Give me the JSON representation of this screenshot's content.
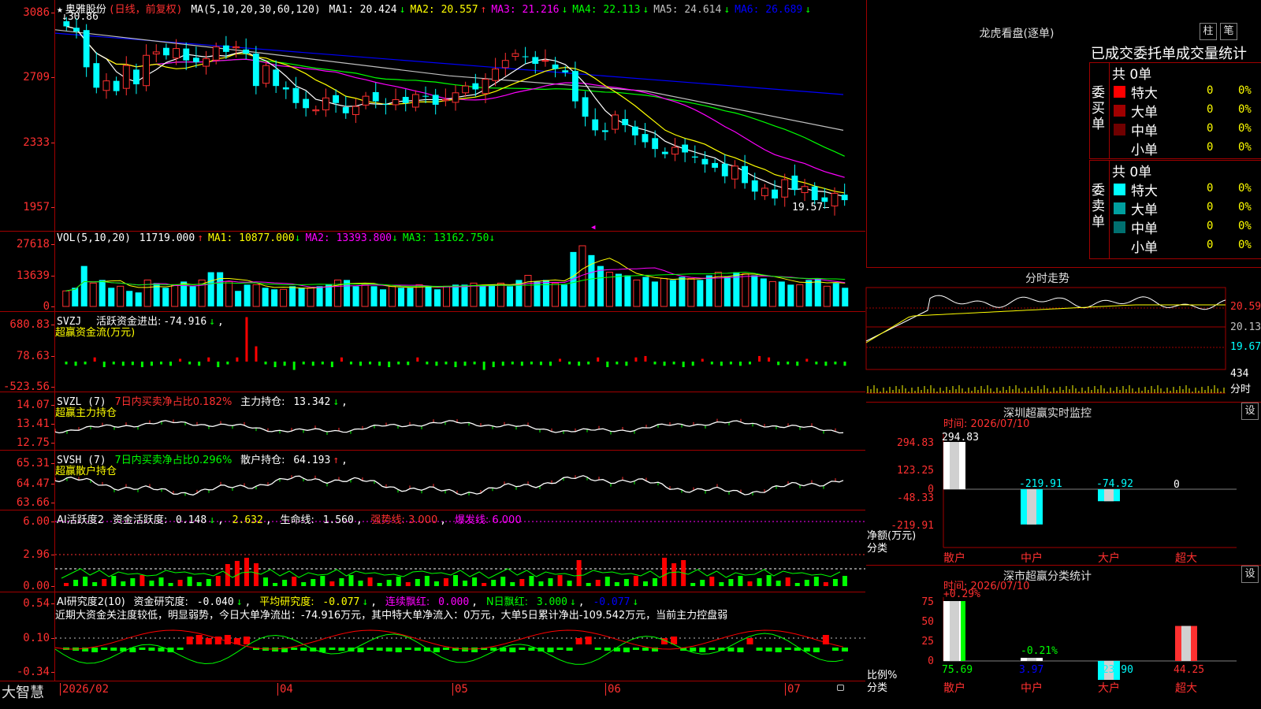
{
  "colors": {
    "up": "#ff3030",
    "down": "#00ffff",
    "bg": "#000000",
    "grid": "#a00000",
    "ma1": "#ffffff",
    "ma2": "#ffff00",
    "ma3": "#ff00ff",
    "ma4": "#00ff00",
    "ma5": "#c0c0c0",
    "ma6": "#0000ff",
    "green": "#00ff00"
  },
  "stock": {
    "name": "奥雅股份",
    "mode": "(日线，前复权)",
    "high_label": "30.86",
    "low_label": "19.57"
  },
  "kline": {
    "ma_legend": "MA(5,10,20,30,60,120)",
    "ma": [
      {
        "name": "MA1:",
        "value": "20.424",
        "arrow": "↓",
        "color": "#ffffff"
      },
      {
        "name": "MA2:",
        "value": "20.557",
        "arrow": "↑",
        "color": "#ffff00"
      },
      {
        "name": "MA3:",
        "value": "21.216",
        "arrow": "↓",
        "color": "#ff00ff"
      },
      {
        "name": "MA4:",
        "value": "22.113",
        "arrow": "↓",
        "color": "#00ff00"
      },
      {
        "name": "MA5:",
        "value": "24.614",
        "arrow": "↓",
        "color": "#c0c0c0"
      },
      {
        "name": "MA6:",
        "value": "26.689",
        "arrow": "↓",
        "color": "#0000ff"
      }
    ],
    "yticks": [
      "3086",
      "2709",
      "2333",
      "1957"
    ],
    "ylim": [
      19.2,
      31.5
    ],
    "closes": [
      30.6,
      30.3,
      28.2,
      27.0,
      27.4,
      26.8,
      28.3,
      27.2,
      28.9,
      29.1,
      28.9,
      29.3,
      28.6,
      28.5,
      28.7,
      29.4,
      29.1,
      29.4,
      29.0,
      27.1,
      28.3,
      27.1,
      26.9,
      26.1,
      25.8,
      25.7,
      26.4,
      26.1,
      25.5,
      25.9,
      26.5,
      26.2,
      26.0,
      26.3,
      26.1,
      26.6,
      26.5,
      26.0,
      26.3,
      26.7,
      27.1,
      26.9,
      27.5,
      28.1,
      28.6,
      29.0,
      28.8,
      28.4,
      28.6,
      28.1,
      27.9,
      26.2,
      25.3,
      24.5,
      24.4,
      25.4,
      24.8,
      24.2,
      23.8,
      23.4,
      23.1,
      23.5,
      23.2,
      22.9,
      22.5,
      22.3,
      21.8,
      22.4,
      21.4,
      20.9,
      21.1,
      20.5,
      21.6,
      21.0,
      21.2,
      20.4,
      20.3,
      20.8,
      20.4
    ]
  },
  "vol": {
    "legend_name": "VOL(5,10,20)",
    "value": "11719.000",
    "arrow": "↑",
    "ma": [
      {
        "name": "MA1:",
        "value": "10877.000",
        "arrow": "↓",
        "color": "#ffff00"
      },
      {
        "name": "MA2:",
        "value": "13393.800",
        "arrow": "↓",
        "color": "#ff00ff"
      },
      {
        "name": "MA3:",
        "value": "13162.750",
        "arrow": "↓",
        "color": "#00ff00"
      }
    ],
    "yticks": [
      "27618",
      "13639",
      "0"
    ],
    "values": [
      10,
      12,
      26,
      15,
      17,
      12,
      13,
      10,
      9,
      17,
      15,
      12,
      14,
      16,
      13,
      17,
      22,
      22,
      16,
      10,
      14,
      14,
      12,
      11,
      11,
      13,
      12,
      12,
      13,
      14,
      17,
      17,
      13,
      14,
      13,
      11,
      13,
      12,
      12,
      14,
      13,
      11,
      13,
      14,
      14,
      15,
      13,
      14,
      15,
      13,
      17,
      20,
      16,
      17,
      15,
      14,
      35,
      39,
      33,
      26,
      22,
      21,
      20,
      17,
      19,
      16,
      18,
      17,
      19,
      18,
      17,
      20,
      22,
      19,
      22,
      21,
      20,
      18,
      16,
      16,
      14,
      14,
      17,
      18,
      13,
      15,
      12
    ]
  },
  "svzj": {
    "title": "SVZJ",
    "label": "活跃资金进出:",
    "value": "-74.916",
    "arrow": "↓",
    "sub": "超赢资金流(万元)",
    "yticks": [
      "680.83",
      "78.63",
      "-523.56"
    ],
    "values": [
      -40,
      -60,
      -40,
      60,
      -80,
      -40,
      -60,
      -50,
      -80,
      -60,
      -40,
      -60,
      40,
      -40,
      -60,
      60,
      -80,
      -40,
      60,
      640,
      220,
      -40,
      -80,
      -60,
      -120,
      -40,
      -60,
      -40,
      -80,
      60,
      -40,
      -60,
      -40,
      -60,
      -80,
      -40,
      -50,
      60,
      -40,
      -60,
      -40,
      -80,
      -60,
      -40,
      -120,
      -80,
      -60,
      -40,
      -60,
      -40,
      -50,
      -60,
      40,
      -40,
      -60,
      -40,
      60,
      -80,
      -40,
      -60,
      60,
      80,
      -40,
      -60,
      -40,
      -80,
      -60,
      40,
      -40,
      -60,
      -40,
      -60,
      -40,
      80,
      60,
      -50,
      -40,
      -60,
      40,
      -40,
      -60,
      -40,
      -60
    ]
  },
  "svzl": {
    "title": "SVZL (7)",
    "label_ratio": "7日内买卖净占比0.182%",
    "label_main": "主力持仓:",
    "value": "13.342",
    "arrow": "↓",
    "sub": "超赢主力持仓",
    "yticks": [
      "14.07",
      "13.41",
      "12.75"
    ]
  },
  "svsh": {
    "title": "SVSH (7)",
    "label_ratio": "7日内买卖净占比0.296%",
    "label_main": "散户持仓:",
    "value": "64.193",
    "arrow": "↑",
    "sub": "超赢散户持仓",
    "yticks": [
      "65.31",
      "64.47",
      "63.66"
    ]
  },
  "ai1": {
    "title": "AI活跃度2",
    "label": "资金活跃度:",
    "value": "0.148",
    "arrow": "↓",
    "v2": "2.632",
    "life_label": "生命线:",
    "life": "1.560",
    "strong": "强势线: 3.000",
    "burst": "爆发线: 6.000",
    "yticks": [
      "6.00",
      "2.96",
      "0.00"
    ]
  },
  "ai2": {
    "title": "AI研究度2(10)",
    "label1": "资金研究度:",
    "v1": "-0.040",
    "label2": "平均研究度:",
    "v2": "-0.077",
    "label3": "连续飘红:",
    "v3": "0.000",
    "label4": "N日飘红:",
    "v4": "3.000",
    "v5": "-0.077",
    "commentary": "近期大资金关注度较低，明显弱势，今日大单净流出：-74.916万元，其中特大单净流入：0万元，大单5日累计净出-109.542万元，当前主力控盘弱",
    "yticks": [
      "0.54",
      "0.10",
      "-0.34"
    ]
  },
  "xaxis": {
    "labels": [
      "2026/02",
      "04",
      "05",
      "06",
      "07"
    ],
    "brand": "大智慧"
  },
  "longhu": {
    "title": "龙虎看盘(逐单)",
    "btn1": "柱",
    "btn2": "笔",
    "header": "已成交委托单成交量统计",
    "buy": {
      "title": "委买单",
      "total": "共 0单",
      "rows": [
        {
          "label": "特大",
          "vol": "0",
          "pct": "0%",
          "color": "#ff0000"
        },
        {
          "label": "大单",
          "vol": "0",
          "pct": "0%",
          "color": "#a00000"
        },
        {
          "label": "中单",
          "vol": "0",
          "pct": "0%",
          "color": "#700000"
        },
        {
          "label": "小单",
          "vol": "0",
          "pct": "0%",
          "color": ""
        }
      ]
    },
    "sell": {
      "title": "委卖单",
      "total": "共 0单",
      "rows": [
        {
          "label": "特大",
          "vol": "0",
          "pct": "0%",
          "color": "#00ffff"
        },
        {
          "label": "大单",
          "vol": "0",
          "pct": "0%",
          "color": "#00a0a0"
        },
        {
          "label": "中单",
          "vol": "0",
          "pct": "0%",
          "color": "#007070"
        },
        {
          "label": "小单",
          "vol": "0",
          "pct": "0%",
          "color": ""
        }
      ]
    }
  },
  "intraday": {
    "title": "分时走势",
    "p1": "20.59",
    "p2": "20.13",
    "p3": "19.67",
    "vol": "434",
    "vol_label": "分时"
  },
  "sz_monitor": {
    "title": "深圳超赢实时监控",
    "btn": "设",
    "time": "时间: 2026/07/10",
    "yticks": [
      "294.83",
      "123.25",
      "0",
      "-48.33",
      "-219.91"
    ],
    "ylabel": "净额(万元)",
    "xlabel": "分类",
    "bars": [
      {
        "cat": "散户",
        "value": 294.83,
        "label": "294.83"
      },
      {
        "cat": "中户",
        "value": -219.91,
        "label": "-219.91"
      },
      {
        "cat": "大户",
        "value": -74.92,
        "label": "-74.92"
      },
      {
        "cat": "超大",
        "value": 0,
        "label": "0"
      }
    ]
  },
  "sz_stats": {
    "title": "深市超赢分类统计",
    "btn": "设",
    "time": "时间: 2026/07/10",
    "top_label": "+0.29%",
    "mid_label": "-0.21%",
    "yticks": [
      "75",
      "50",
      "25",
      "0"
    ],
    "ylabel": "比例%",
    "xlabel": "分类",
    "bars": [
      {
        "cat": "散户",
        "value": 75.69,
        "label": "75.69"
      },
      {
        "cat": "中户",
        "value": 3.97,
        "label": "3.97"
      },
      {
        "cat": "大户",
        "value": -23.9,
        "label": "-23.90"
      },
      {
        "cat": "超大",
        "value": 44.25,
        "label": "44.25"
      }
    ]
  }
}
